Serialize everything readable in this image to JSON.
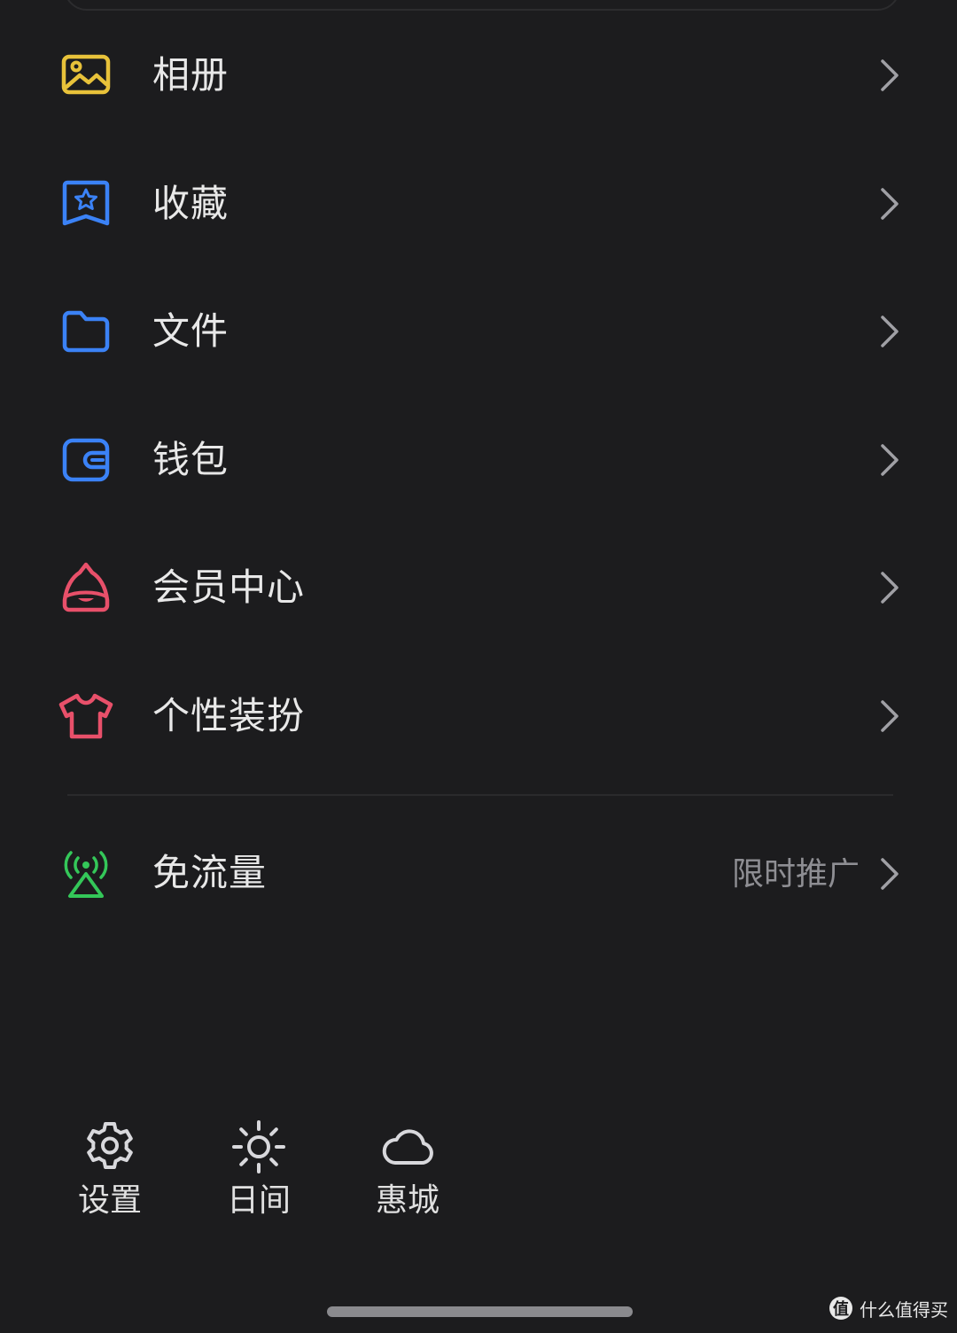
{
  "menu": {
    "items": [
      {
        "label": "相册",
        "icon": "album-icon",
        "color": "#e8c23a"
      },
      {
        "label": "收藏",
        "icon": "favorites-icon",
        "color": "#3b82f6"
      },
      {
        "label": "文件",
        "icon": "folder-icon",
        "color": "#3b82f6"
      },
      {
        "label": "钱包",
        "icon": "wallet-icon",
        "color": "#3b82f6"
      },
      {
        "label": "会员中心",
        "icon": "member-center-icon",
        "color": "#e8506a"
      },
      {
        "label": "个性装扮",
        "icon": "tshirt-icon",
        "color": "#e8506a"
      }
    ]
  },
  "free_data": {
    "label": "免流量",
    "hint": "限时推广",
    "icon": "signal-tower-icon",
    "color": "#34c759"
  },
  "bottom_bar": {
    "settings": {
      "label": "设置",
      "icon": "gear-icon"
    },
    "day_mode": {
      "label": "日间",
      "icon": "sun-icon"
    },
    "huicheng": {
      "label": "惠城",
      "icon": "cloud-icon"
    }
  },
  "watermark": {
    "text": "什么值得买",
    "logo": "值"
  }
}
